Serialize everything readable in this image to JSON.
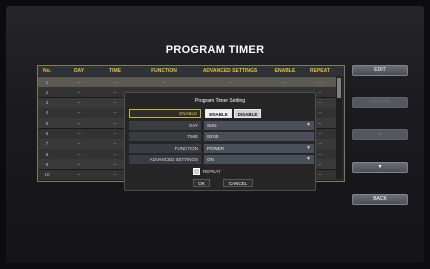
{
  "title": "PROGRAM TIMER",
  "table": {
    "headers": [
      "No.",
      "DAY",
      "TIME",
      "FUNCTION",
      "ADVANCED SETTINGS",
      "ENABLE",
      "REPEAT"
    ],
    "rows": [
      {
        "no": "1",
        "day": "--",
        "time": "--",
        "function": "--",
        "adv": "--",
        "enable": "--",
        "repeat": "--"
      },
      {
        "no": "2",
        "day": "--",
        "time": "--",
        "function": "--",
        "adv": "--",
        "enable": "--",
        "repeat": "--"
      },
      {
        "no": "3",
        "day": "--",
        "time": "--",
        "function": "--",
        "adv": "--",
        "enable": "--",
        "repeat": "--"
      },
      {
        "no": "4",
        "day": "--",
        "time": "--",
        "function": "--",
        "adv": "--",
        "enable": "--",
        "repeat": "--"
      },
      {
        "no": "5",
        "day": "--",
        "time": "--",
        "function": "--",
        "adv": "--",
        "enable": "--",
        "repeat": "--"
      },
      {
        "no": "6",
        "day": "--",
        "time": "--",
        "function": "--",
        "adv": "--",
        "enable": "--",
        "repeat": "--"
      },
      {
        "no": "7",
        "day": "--",
        "time": "--",
        "function": "--",
        "adv": "--",
        "enable": "--",
        "repeat": "--"
      },
      {
        "no": "8",
        "day": "--",
        "time": "--",
        "function": "--",
        "adv": "--",
        "enable": "--",
        "repeat": "--"
      },
      {
        "no": "9",
        "day": "--",
        "time": "--",
        "function": "--",
        "adv": "--",
        "enable": "--",
        "repeat": "--"
      },
      {
        "no": "10",
        "day": "--",
        "time": "--",
        "function": "--",
        "adv": "--",
        "enable": "--",
        "repeat": "--"
      }
    ]
  },
  "side_buttons": {
    "edit": "EDIT",
    "delete": "DELETE",
    "up": "▲",
    "down": "▼",
    "back": "BACK"
  },
  "dialog": {
    "title": "Program Timer Setting",
    "enable_label": "ENABLE",
    "enable_option": "ENABLE",
    "disable_option": "DISABLE",
    "day_label": "DAY",
    "day_value": "SUN",
    "time_label": "TIME",
    "time_value": "00:00",
    "function_label": "FUNCTION",
    "function_value": "POWER",
    "advanced_label": "ADVANCED SETTINGS",
    "advanced_value": "ON",
    "repeat_label": "REPEAT",
    "ok": "OK",
    "cancel": "CANCEL",
    "dropdown_icon": "▼"
  },
  "colors": {
    "header_text": "#e5c52b",
    "accent_border": "#c8b340"
  }
}
